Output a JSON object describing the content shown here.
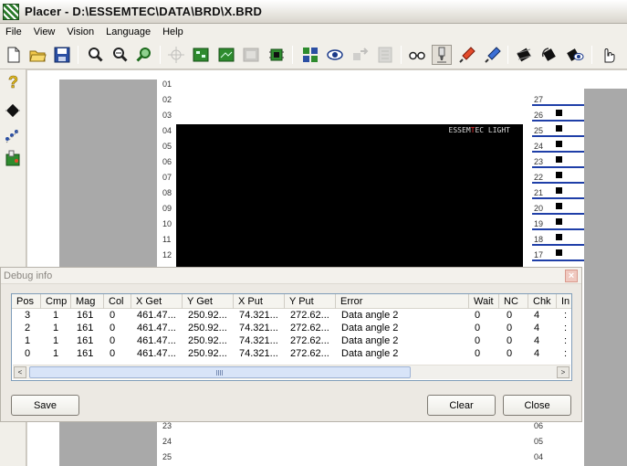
{
  "window": {
    "title": "Placer - D:\\ESSEMTEC\\DATA\\BRD\\X.BRD"
  },
  "menu": [
    "File",
    "View",
    "Vision",
    "Language",
    "Help"
  ],
  "toolbar_icons": [
    "new-file-icon",
    "open-folder-icon",
    "save-disk-icon",
    "zoom-in-icon",
    "zoom-out-icon",
    "zoom-fit-icon",
    "crosshair-icon",
    "board-green-icon",
    "board-green-2-icon",
    "board-grey-icon",
    "camera-chip-icon",
    "feeder-grid-icon",
    "eye-icon",
    "arrows-icon",
    "list-grey-icon",
    "glasses-icon",
    "nozzle-icon",
    "syringe-red-icon",
    "syringe-blue-icon",
    "chip-icon",
    "chip-rotate-icon",
    "chip-eye-icon",
    "hand-pointer-icon"
  ],
  "sidebar_icons": [
    "question-mark-icon",
    "chip-diamond-icon",
    "component-dots-icon",
    "pcb-board-icon"
  ],
  "canvas": {
    "brand_pre": "ESSEM",
    "brand_mid": "T",
    "brand_post": "EC LIGHT"
  },
  "left_ruler_top": [
    "01",
    "02",
    "03",
    "04",
    "05",
    "06",
    "07",
    "08",
    "09",
    "10",
    "11",
    "12"
  ],
  "left_ruler_bottom": [
    "23",
    "24",
    "25"
  ],
  "right_ruler_top": [
    "27",
    "26",
    "25",
    "24",
    "23",
    "22",
    "21",
    "20",
    "19",
    "18",
    "17"
  ],
  "right_ruler_bottom": [
    "06",
    "05",
    "04"
  ],
  "debug": {
    "title": "Debug info",
    "close": "×",
    "columns": [
      "Pos",
      "Cmp",
      "Mag",
      "Col",
      "X Get",
      "Y Get",
      "X Put",
      "Y Put",
      "Error",
      "Wait",
      "NC",
      "Chk",
      "In"
    ],
    "rows": [
      [
        "3",
        "1",
        "161",
        "0",
        "461.47...",
        "250.92...",
        "74.321...",
        "272.62...",
        "Data angle 2",
        "0",
        "0",
        "4",
        ":"
      ],
      [
        "2",
        "1",
        "161",
        "0",
        "461.47...",
        "250.92...",
        "74.321...",
        "272.62...",
        "Data angle 2",
        "0",
        "0",
        "4",
        ":"
      ],
      [
        "1",
        "1",
        "161",
        "0",
        "461.47...",
        "250.92...",
        "74.321...",
        "272.62...",
        "Data angle 2",
        "0",
        "0",
        "4",
        ":"
      ],
      [
        "0",
        "1",
        "161",
        "0",
        "461.47...",
        "250.92...",
        "74.321...",
        "272.62...",
        "Data angle 2",
        "0",
        "0",
        "4",
        ":"
      ]
    ],
    "scroll_left": "<",
    "scroll_right": ">",
    "buttons": {
      "save": "Save",
      "clear": "Clear",
      "close": "Close"
    }
  },
  "colors": {
    "ruler_line": "#1f3fa8",
    "canvas_bg": "#000000",
    "brand_accent": "#e33333"
  }
}
